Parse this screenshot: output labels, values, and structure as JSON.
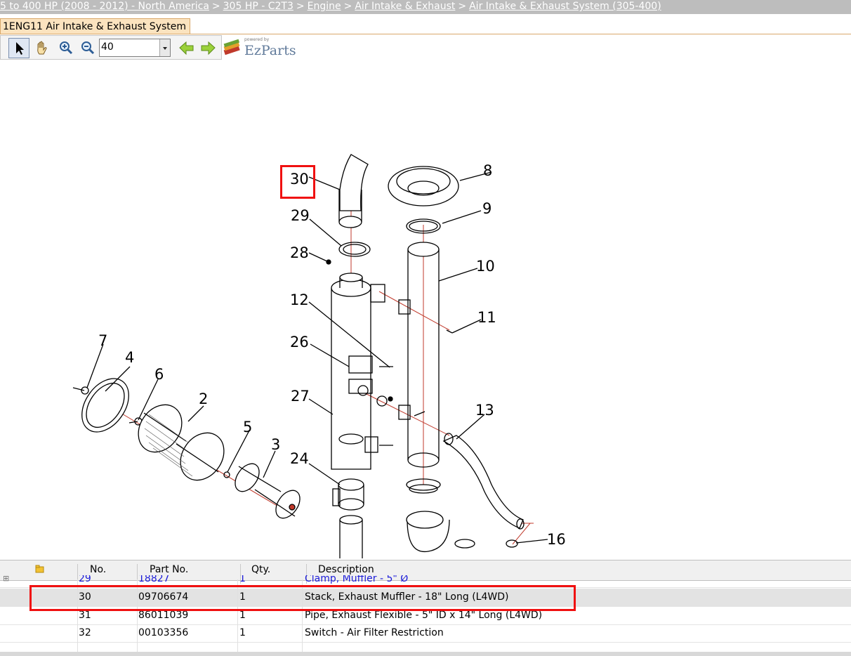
{
  "breadcrumb": {
    "items": [
      "5 to 400 HP (2008 - 2012) - North America",
      "305 HP - C2T3",
      "Engine",
      "Air Intake & Exhaust",
      "Air Intake & Exhaust System (305-400)"
    ],
    "separator": ">"
  },
  "tab": {
    "label": "1ENG11 Air Intake & Exhaust System"
  },
  "toolbar": {
    "zoom_value": "40",
    "select_icon": "arrow-pointer-icon",
    "pan_icon": "hand-icon",
    "zoom_in_icon": "zoom-in-icon",
    "zoom_out_icon": "zoom-out-icon",
    "back_icon": "arrow-left-icon",
    "forward_icon": "arrow-right-icon"
  },
  "brand": {
    "powered_by": "powered by",
    "name": "EzParts"
  },
  "diagram": {
    "callouts": [
      "30",
      "8",
      "29",
      "9",
      "28",
      "10",
      "12",
      "11",
      "26",
      "7",
      "4",
      "6",
      "2",
      "27",
      "13",
      "5",
      "3",
      "24",
      "16"
    ],
    "highlighted_callout": "30"
  },
  "table": {
    "headers": {
      "icon": "folder-icon",
      "no": "No.",
      "part_no": "Part No.",
      "qty": "Qty.",
      "description": "Description"
    },
    "rows": [
      {
        "no": "29",
        "part_no": "18827",
        "qty": "1",
        "description": "Clamp, Muffler - 5\" Ø"
      },
      {
        "no": "30",
        "part_no": "09706674",
        "qty": "1",
        "description": "Stack, Exhaust Muffler - 18\" Long (L4WD)"
      },
      {
        "no": "31",
        "part_no": "86011039",
        "qty": "1",
        "description": "Pipe, Exhaust Flexible - 5\" ID x 14\" Long (L4WD)"
      },
      {
        "no": "32",
        "part_no": "00103356",
        "qty": "1",
        "description": "Switch - Air Filter Restriction"
      }
    ]
  },
  "colors": {
    "highlight": "#f01010",
    "selected_row": "#e3e3e3",
    "breadcrumb_bg": "#bdbdbd",
    "tab_bg": "#fbe3bf"
  }
}
